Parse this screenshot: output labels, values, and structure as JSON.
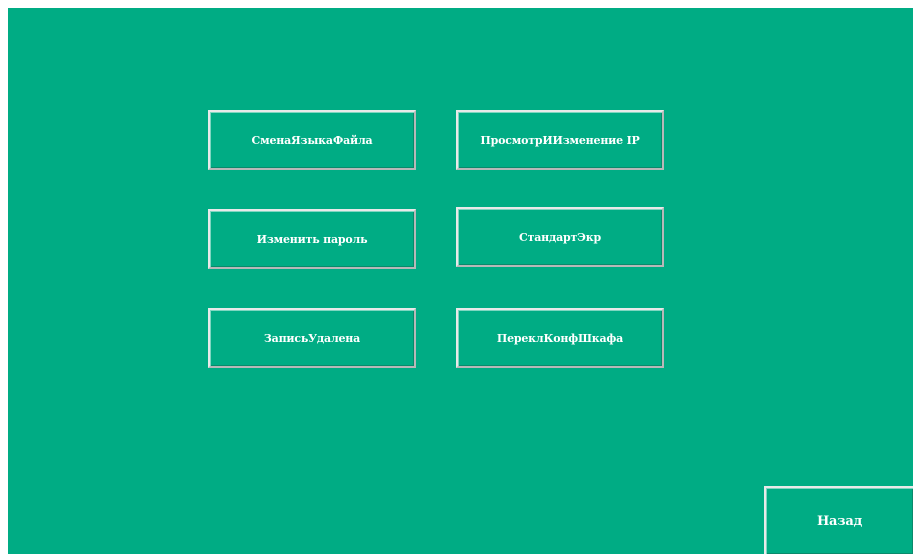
{
  "menu": {
    "buttons": [
      {
        "label": "СменаЯзыкаФайла"
      },
      {
        "label": "ПросмотрИИзменение IP"
      },
      {
        "label": "Изменить пароль"
      },
      {
        "label": "СтандартЭкр"
      },
      {
        "label": "ЗаписьУдалена"
      },
      {
        "label": "ПереклКонфШкафа"
      }
    ]
  },
  "footer": {
    "back_label": "Назад"
  },
  "colors": {
    "background": "#00ac84",
    "text": "#ffffff",
    "border_light": "#e9e9e9",
    "border_dark": "#b8b8b8"
  }
}
